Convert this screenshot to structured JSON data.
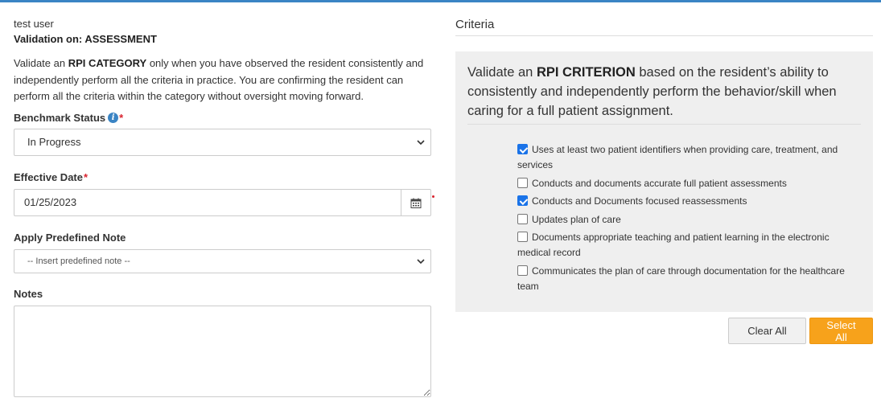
{
  "left": {
    "user": "test user",
    "validation_on": "Validation on: ASSESSMENT",
    "intro_part1": "Validate an ",
    "intro_bold": "RPI CATEGORY",
    "intro_part2": " only when you have observed the resident consistently and independently perform all the criteria in practice. You are confirming the resident can perform all the criteria within the category without oversight moving forward.",
    "benchmark_label": "Benchmark Status",
    "benchmark_value": "In Progress",
    "effective_label": "Effective Date",
    "effective_value": "01/25/2023",
    "predefined_label": "Apply Predefined Note",
    "predefined_value": "-- Insert predefined note --",
    "notes_label": "Notes",
    "notes_value": "",
    "required_mark": "*"
  },
  "right": {
    "title": "Criteria",
    "panel_part1": "Validate an ",
    "panel_bold": "RPI CRITERION",
    "panel_part2": " based on the resident’s ability to consistently and independently perform the behavior/skill when caring for a full patient assignment.",
    "criteria": [
      {
        "label": "Uses at least two patient identifiers when providing care, treatment, and services",
        "checked": true
      },
      {
        "label": "Conducts and documents accurate full patient assessments",
        "checked": false
      },
      {
        "label": "Conducts and Documents focused reassessments",
        "checked": true
      },
      {
        "label": "Updates plan of care",
        "checked": false
      },
      {
        "label": "Documents appropriate teaching and patient learning in the electronic medical record",
        "checked": false
      },
      {
        "label": "Communicates the plan of care through documentation for the healthcare team",
        "checked": false
      }
    ],
    "clear_all": "Clear All",
    "select_all": "Select All"
  },
  "colors": {
    "accent": "#3a84c4",
    "required": "#d9232e",
    "select_all_bg": "#f7a21b",
    "panel_bg": "#efefef",
    "checkbox_checked": "#1a73e8"
  },
  "icons": {
    "benchmark_info": "info-icon",
    "date_picker": "calendar-icon",
    "dropdown": "chevron-down-icon"
  }
}
